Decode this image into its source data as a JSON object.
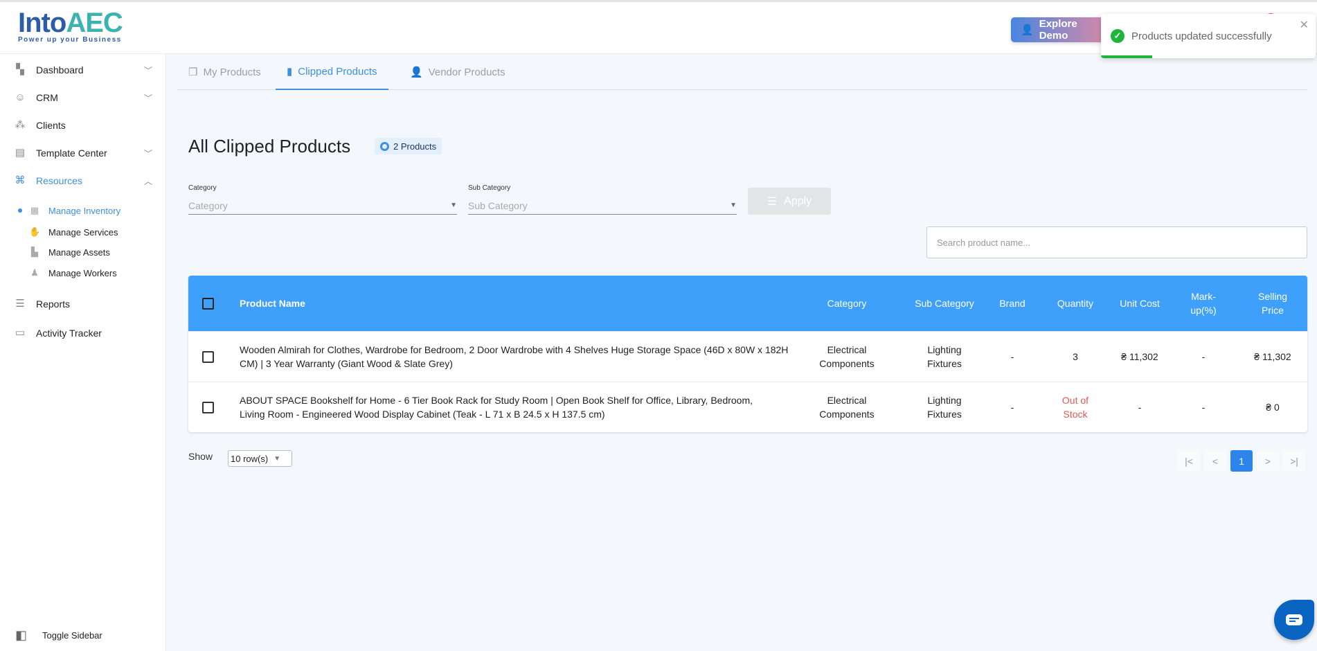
{
  "app": {
    "logo_text": "IntoAEC",
    "logo_tagline": "Power up your Business",
    "explore_demo": "Explore Demo"
  },
  "toast": {
    "message": "Products updated successfully",
    "progress_percent": 24,
    "color": "#1fb53a"
  },
  "sidebar": {
    "items": [
      {
        "label": "Dashboard",
        "icon": "dashboard-icon",
        "expandable": true
      },
      {
        "label": "CRM",
        "icon": "crm-icon",
        "expandable": true
      },
      {
        "label": "Clients",
        "icon": "clients-icon",
        "expandable": false
      },
      {
        "label": "Template Center",
        "icon": "template-icon",
        "expandable": true
      },
      {
        "label": "Resources",
        "icon": "resources-icon",
        "expandable": true,
        "expanded": true
      },
      {
        "label": "Reports",
        "icon": "reports-icon"
      },
      {
        "label": "Activity Tracker",
        "icon": "activity-icon"
      }
    ],
    "sub_items": [
      {
        "label": "Manage Inventory",
        "active": true
      },
      {
        "label": "Manage Services"
      },
      {
        "label": "Manage Assets"
      },
      {
        "label": "Manage Workers"
      }
    ],
    "toggle": "Toggle Sidebar"
  },
  "tabs": [
    {
      "label": "My Products"
    },
    {
      "label": "Clipped Products",
      "active": true
    },
    {
      "label": "Vendor Products"
    }
  ],
  "page": {
    "title": "All Clipped Products",
    "count_badge": "2 Products"
  },
  "filters": {
    "category_label": "Category",
    "category_placeholder": "Category",
    "sub_label": "Sub Category",
    "sub_placeholder": "Sub Category",
    "apply": "Apply"
  },
  "search": {
    "placeholder": "Search product name..."
  },
  "table": {
    "headers": {
      "name": "Product Name",
      "category": "Category",
      "sub": "Sub Category",
      "brand": "Brand",
      "qty": "Quantity",
      "unit": "Unit Cost",
      "markup": "Mark-up(%)",
      "selling": "Selling Price"
    },
    "rows": [
      {
        "name": "Wooden Almirah for Clothes, Wardrobe for Bedroom, 2 Door Wardrobe with 4 Shelves Huge Storage Space (46D x 80W x 182H CM) | 3 Year Warranty (Giant Wood & Slate Grey)",
        "category": "Electrical Components",
        "sub": "Lighting Fixtures",
        "brand": "-",
        "qty": "3",
        "unit": "₴ 11,302",
        "markup": "-",
        "selling": "₴ 11,302"
      },
      {
        "name": "ABOUT SPACE Bookshelf for Home - 6 Tier Book Rack for Study Room | Open Book Shelf for Office, Library, Bedroom, Living Room - Engineered Wood Display Cabinet (Teak - L 71 x B 24.5 x H 137.5 cm)",
        "category": "Electrical Components",
        "sub": "Lighting Fixtures",
        "brand": "-",
        "qty": "Out of Stock",
        "unit": "-",
        "markup": "-",
        "selling": "₴ 0"
      }
    ]
  },
  "pagination": {
    "show": "Show",
    "rows_per_page": "10 row(s)",
    "first": "|<",
    "prev": "<",
    "current": "1",
    "next": ">",
    "last": ">|"
  },
  "colors": {
    "accent": "#3f8fe0",
    "table_header": "#3ea0fa",
    "out_of_stock": "#e05a4f"
  }
}
